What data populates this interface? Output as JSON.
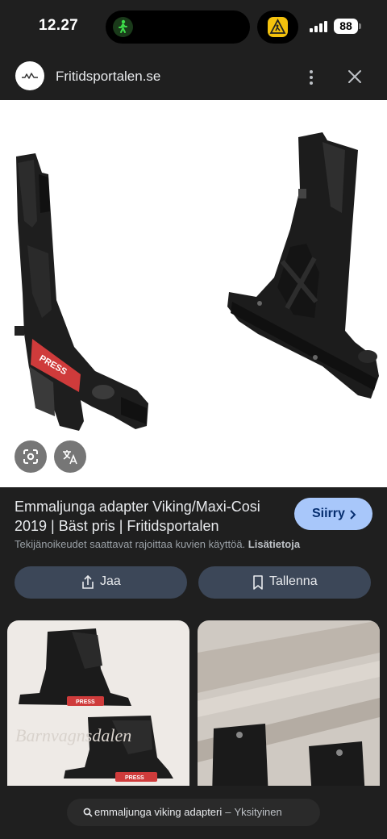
{
  "status_bar": {
    "time": "12.27",
    "battery": "88"
  },
  "site": {
    "name": "Fritidsportalen.se"
  },
  "hero": {
    "product_label": "PRESS"
  },
  "result": {
    "title": "Emmaljunga adapter Viking/Maxi-Cosi 2019 | Bäst pris | Fritidsportalen",
    "visit_label": "Siirry",
    "copyright_text": "Tekijänoikeudet saattavat rajoittaa kuvien käyttöä.",
    "learn_more": "Lisätietoja",
    "share_label": "Jaa",
    "save_label": "Tallenna"
  },
  "related": {
    "left_label": "PRESS",
    "right_label": "PRESS"
  },
  "search": {
    "query": "emmaljunga viking adapteri",
    "separator": "–",
    "mode": "Yksityinen"
  },
  "colors": {
    "background": "#1f1f1f",
    "accent": "#a8c7fa",
    "button": "#3c4758"
  }
}
